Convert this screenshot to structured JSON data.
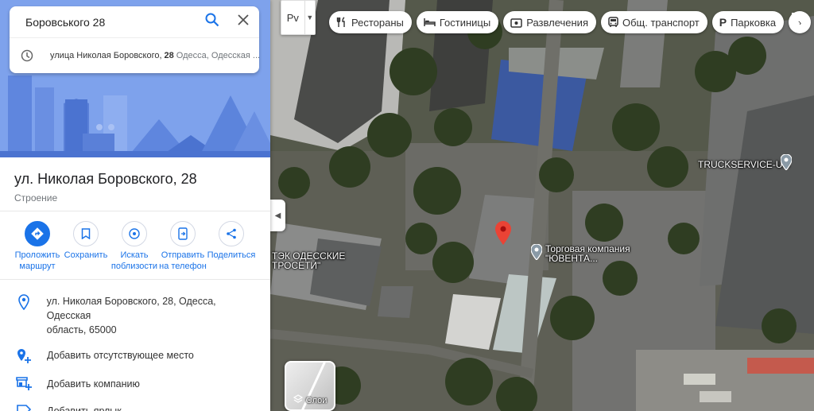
{
  "search": {
    "query": "Боровського 28",
    "suggestion_main": "улица Николая Боровского,",
    "suggestion_bold": "28",
    "suggestion_sub": "Одесса, Одесская ..."
  },
  "place": {
    "title": "ул. Николая Боровского, 28",
    "category": "Строение"
  },
  "actions": [
    {
      "line1": "Проложить",
      "line2": "маршрут"
    },
    {
      "line1": "Сохранить",
      "line2": ""
    },
    {
      "line1": "Искать",
      "line2": "поблизости"
    },
    {
      "line1": "Отправить",
      "line2": "на телефон"
    },
    {
      "line1": "Поделиться",
      "line2": ""
    }
  ],
  "info": {
    "address_line1": "ул. Николая Боровского, 28, Одесса, Одесская",
    "address_line2": "область, 65000",
    "add_missing_place": "Добавить отсутствующее место",
    "add_business": "Добавить компанию",
    "add_label": "Добавить ярлык"
  },
  "map": {
    "layer_toggle_label": "Pv",
    "chips": [
      {
        "label": "Рестораны",
        "icon": "fork-knife-icon"
      },
      {
        "label": "Гостиницы",
        "icon": "bed-icon"
      },
      {
        "label": "Развлечения",
        "icon": "ticket-icon"
      },
      {
        "label": "Общ. транспорт",
        "icon": "bus-icon"
      },
      {
        "label": "Парковка",
        "icon": "parking-icon"
      }
    ],
    "labels": {
      "truckservice": "TRUCKSERVICE-UG",
      "company_line1": "Торговая компания",
      "company_line2": "\"ЮВЕНТА...",
      "tec_line1": "ТЭК ОДЕССКИЕ",
      "tec_line2": "ТРОСЕТИ\""
    },
    "layers_label": "Слои"
  },
  "colors": {
    "accent": "#1a73e8",
    "pin": "#ea4335",
    "hero": "#7ea2ec"
  }
}
